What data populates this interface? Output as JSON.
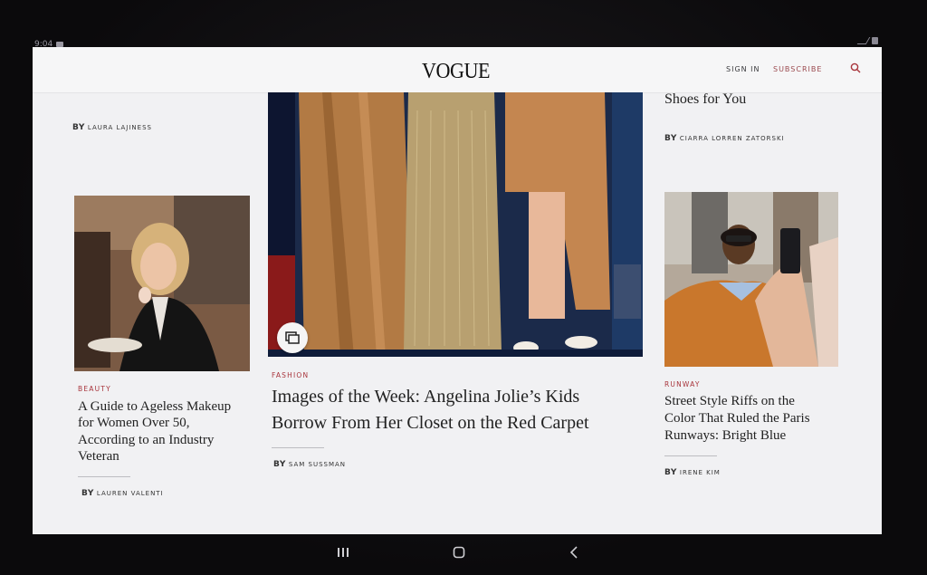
{
  "status": {
    "time": "9:04"
  },
  "header": {
    "logo": "VOGUE",
    "sign_in": "SIGN IN",
    "subscribe": "SUBSCRIBE"
  },
  "left_column": {
    "top_byline": {
      "by": "BY",
      "author": "LAURA LAJINESS"
    },
    "article": {
      "kicker": "BEAUTY",
      "headline_lines": [
        "A Guide to Ageless Makeup",
        "for Women Over 50,",
        "According to an Industry",
        "Veteran"
      ],
      "by": "BY",
      "author": "LAUREN VALENTI"
    }
  },
  "center_column": {
    "article": {
      "kicker": "FASHION",
      "headline_lines": [
        "Images of the Week: Angelina Jolie’s Kids",
        "Borrow From Her Closet on the Red Carpet"
      ],
      "by": "BY",
      "author": "SAM SUSSMAN"
    }
  },
  "right_column": {
    "top_headline_fragment": "Shoes for You",
    "top_byline": {
      "by": "BY",
      "author": "CIARRA LORREN ZATORSKI"
    },
    "article": {
      "kicker": "RUNWAY",
      "headline_lines": [
        "Street Style Riffs on the",
        "Color That Ruled the Paris",
        "Runways: Bright Blue"
      ],
      "by": "BY",
      "author": "IRENE KIM"
    }
  },
  "icons": {
    "search": "search-icon",
    "gallery": "gallery-icon",
    "nav_recents": "recents-icon",
    "nav_home": "home-icon",
    "nav_back": "back-icon"
  },
  "colors": {
    "accent": "#a8343b",
    "background": "#f1f1f3",
    "text": "#222222"
  }
}
